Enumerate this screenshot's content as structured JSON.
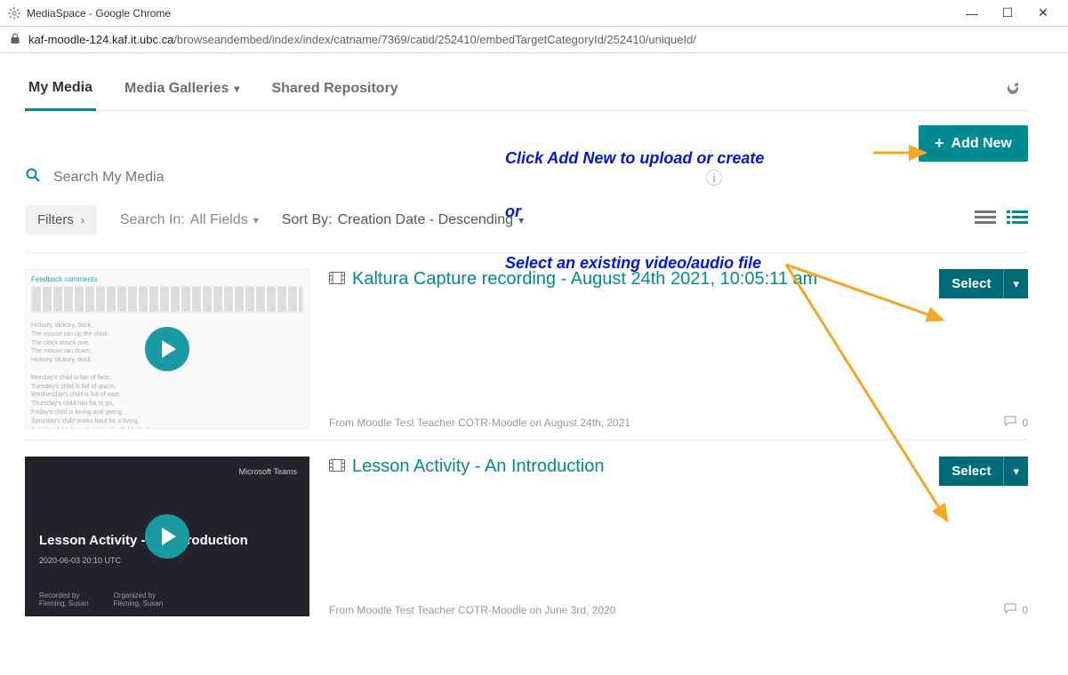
{
  "window": {
    "title": "MediaSpace - Google Chrome",
    "minimize": "—",
    "maximize": "☐",
    "close": "✕"
  },
  "url": {
    "host": "kaf-moodle-124.kaf.it.ubc.ca",
    "path": "/browseandembed/index/index/catname/7369/catid/252410/embedTargetCategoryId/252410/uniqueId/"
  },
  "tabs": {
    "my_media": "My Media",
    "media_galleries": "Media Galleries",
    "shared_repository": "Shared Repository"
  },
  "add_new": "Add New",
  "search": {
    "placeholder": "Search My Media"
  },
  "filters_btn": "Filters",
  "search_in_label": "Search In: ",
  "search_in_value": "All Fields",
  "sort_label": "Sort By: ",
  "sort_value": "Creation Date - Descending",
  "annotations": {
    "line1": "Click Add New to upload or create",
    "line2": "or",
    "line3": "Select an existing video/audio file"
  },
  "items": [
    {
      "title": "Kaltura Capture recording - August 24th 2021, 10:05:11 am",
      "from": "From Moodle Test Teacher COTR-Moodle on August 24th, 2021",
      "comments": "0",
      "select": "Select",
      "thumb": {
        "head": "Feedback comments",
        "body": "Hickory, dickory, dock,\nThe mouse ran up the clock.\nThe clock struck one,\nThe mouse ran down,\nHickory, dickory, dock.\n\nMonday's child is fair of face,\nTuesday's child is full of grace,\nWednesday's child is full of woe,\nThursday's child has far to go,\nFriday's child is loving and giving,\nSaturday's child works hard for a living,\nAnd the child that is born on the Sabbath day"
      }
    },
    {
      "title": "Lesson Activity - An Introduction",
      "from": "From Moodle Test Teacher COTR-Moodle on June 3rd, 2020",
      "comments": "0",
      "select": "Select",
      "thumb": {
        "corner": "Microsoft Teams",
        "title": "Lesson Activity - An Introduction",
        "date": "2020-06-03 20:10 UTC",
        "foot1": "Recorded by\nFleming, Susan",
        "foot2": "Organized by\nFleming, Susan"
      }
    }
  ]
}
